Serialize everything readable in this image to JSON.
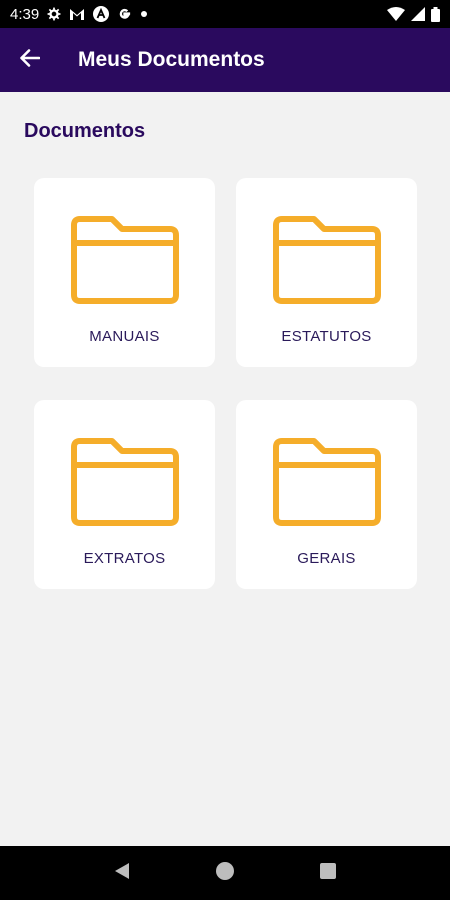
{
  "status_bar": {
    "time": "4:39",
    "icons": [
      "settings-icon",
      "gmail-icon",
      "a-icon",
      "google-icon",
      "dot-icon"
    ],
    "right_icons": [
      "wifi-icon",
      "signal-icon",
      "battery-icon"
    ]
  },
  "app_bar": {
    "back_icon": "arrow-back-icon",
    "title": "Meus Documentos"
  },
  "section": {
    "title": "Documentos"
  },
  "folders": [
    {
      "label": "MANUAIS",
      "icon": "folder-icon"
    },
    {
      "label": "ESTATUTOS",
      "icon": "folder-icon"
    },
    {
      "label": "EXTRATOS",
      "icon": "folder-icon"
    },
    {
      "label": "GERAIS",
      "icon": "folder-icon"
    }
  ],
  "colors": {
    "app_bar": "#2a0a5e",
    "folder": "#f5ad2a",
    "background": "#f2f2f2"
  },
  "nav_bar": {
    "buttons": [
      "back-triangle-icon",
      "home-circle-icon",
      "recents-square-icon"
    ]
  }
}
